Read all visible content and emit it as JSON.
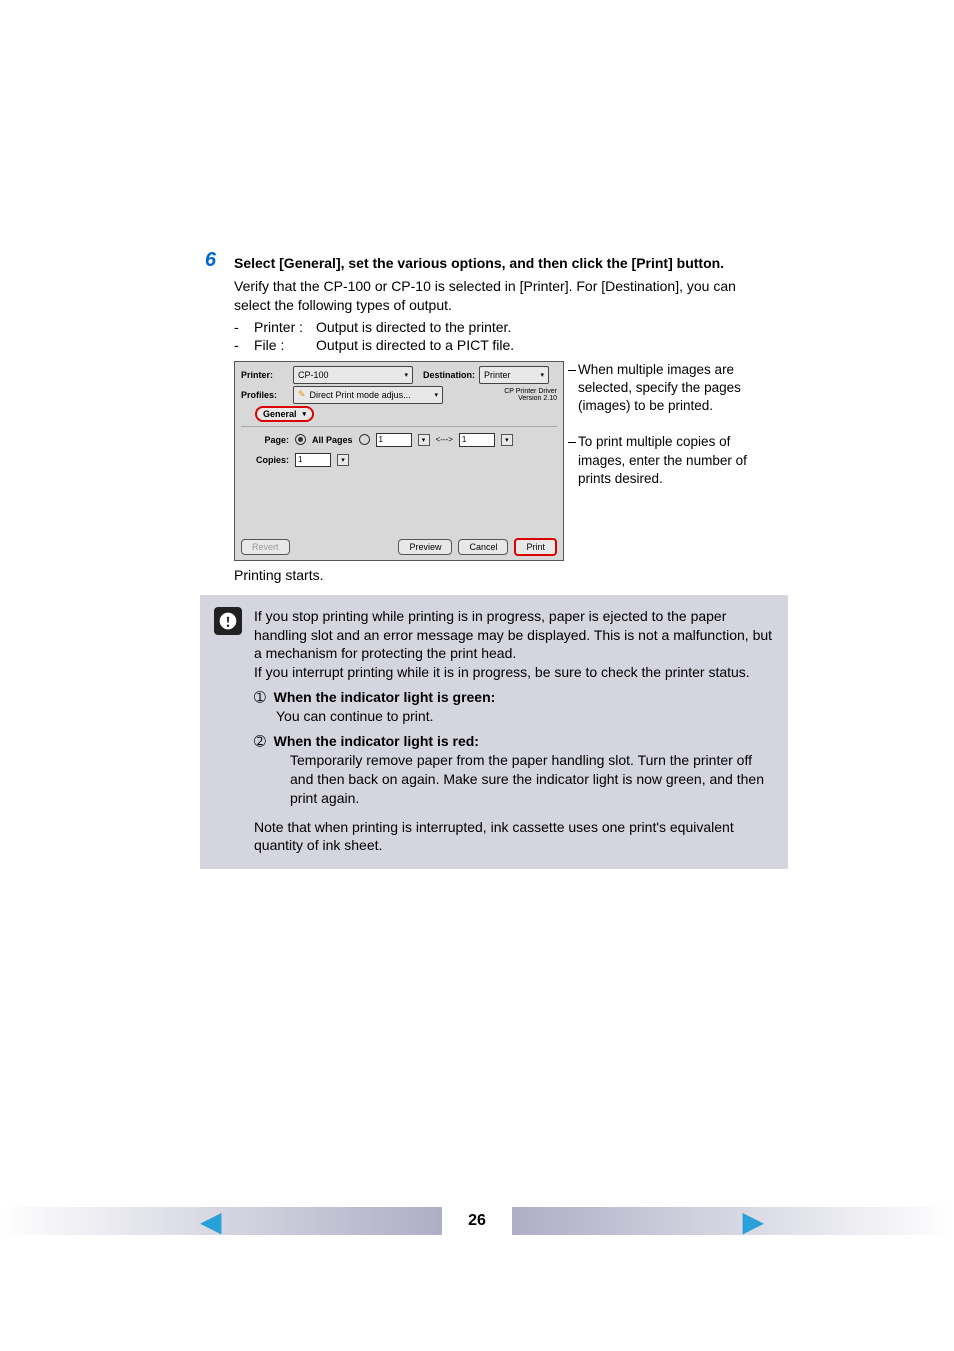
{
  "step": {
    "number": "6",
    "title": "Select [General], set the various options, and then click the [Print] button.",
    "verify": "Verify that the CP-100 or CP-10 is selected in [Printer]. For [Destination], you can select the following types of output.",
    "bullets": [
      {
        "dash": "-",
        "label": "Printer :",
        "text": "Output is directed to the printer."
      },
      {
        "dash": "-",
        "label": "File :",
        "text": "Output is directed to a PICT file."
      }
    ],
    "printing_starts": "Printing starts."
  },
  "dialog": {
    "printer_label": "Printer:",
    "printer_value": "CP-100",
    "destination_label": "Destination:",
    "destination_value": "Printer",
    "profiles_label": "Profiles:",
    "profiles_value": "Direct Print mode adjus...",
    "driver_line1": "CP Printer Driver",
    "driver_line2": "Version 2.10",
    "tab": "General",
    "page_label": "Page:",
    "all_pages": "All Pages",
    "range_from": "1",
    "range_arrow": "<--->",
    "range_to": "1",
    "copies_label": "Copies:",
    "copies_value": "1",
    "revert": "Revert",
    "preview": "Preview",
    "cancel": "Cancel",
    "print": "Print"
  },
  "side": {
    "a": "When multiple images are selected, specify the pages (images) to be printed.",
    "b": "To print multiple copies of images, enter the number of prints desired."
  },
  "note": {
    "p1": "If you stop printing while printing is in progress, paper is ejected to the paper handling slot and an error message may be displayed. This is not a malfunction, but a mechanism for protecting the print head.",
    "p2": "If you interrupt printing while it is in progress, be sure to check the printer status.",
    "n1_mark": "➀",
    "n1_title": "When the indicator light is green:",
    "n1_body": "You can continue to print.",
    "n2_mark": "➁",
    "n2_title": "When the indicator light is red:",
    "n2_body": "Temporarily remove paper from the paper handling slot. Turn the printer off and then back on again. Make sure the indicator light is now green, and then print again.",
    "p3": "Note that when printing is interrupted, ink cassette uses one print's equivalent quantity of ink sheet."
  },
  "page_number": "26"
}
